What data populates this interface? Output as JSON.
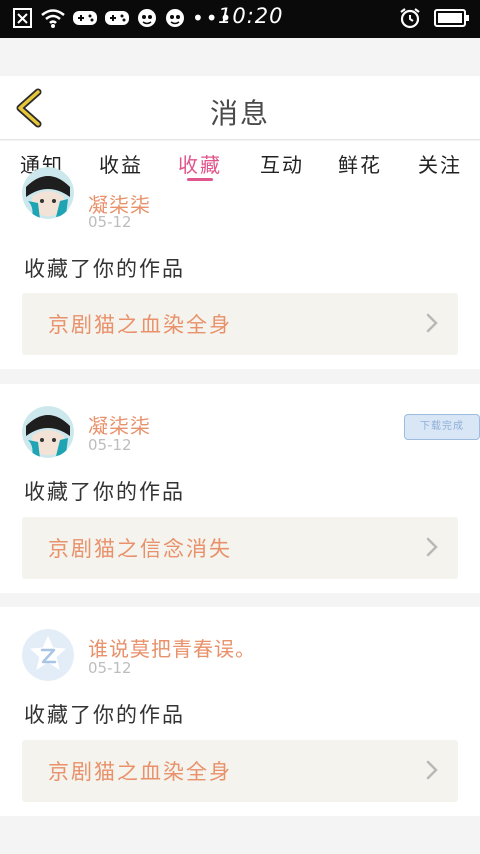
{
  "status_bar": {
    "time": "10:20",
    "dots": "•••"
  },
  "header": {
    "title": "消息"
  },
  "tabs": [
    {
      "label": "通知",
      "active": false
    },
    {
      "label": "收益",
      "active": false
    },
    {
      "label": "收藏",
      "active": true
    },
    {
      "label": "互动",
      "active": false
    },
    {
      "label": "鲜花",
      "active": false
    },
    {
      "label": "关注",
      "active": false
    }
  ],
  "messages": [
    {
      "user": "凝柒柒",
      "date": "05-12",
      "action": "收藏了你的作品",
      "work": "京剧猫之血染全身",
      "avatar": "anime"
    },
    {
      "user": "凝柒柒",
      "date": "05-12",
      "action": "收藏了你的作品",
      "work": "京剧猫之信念消失",
      "avatar": "anime"
    },
    {
      "user": "谁说莫把青春误。",
      "date": "05-12",
      "action": "收藏了你的作品",
      "work": "京剧猫之血染全身",
      "avatar": "default"
    }
  ],
  "overlay_badge": "下载完成",
  "colors": {
    "accent": "#e0558b",
    "username": "#e8916a",
    "work_bg": "#f4f3ed",
    "back_arrow": "#e6c63a"
  }
}
